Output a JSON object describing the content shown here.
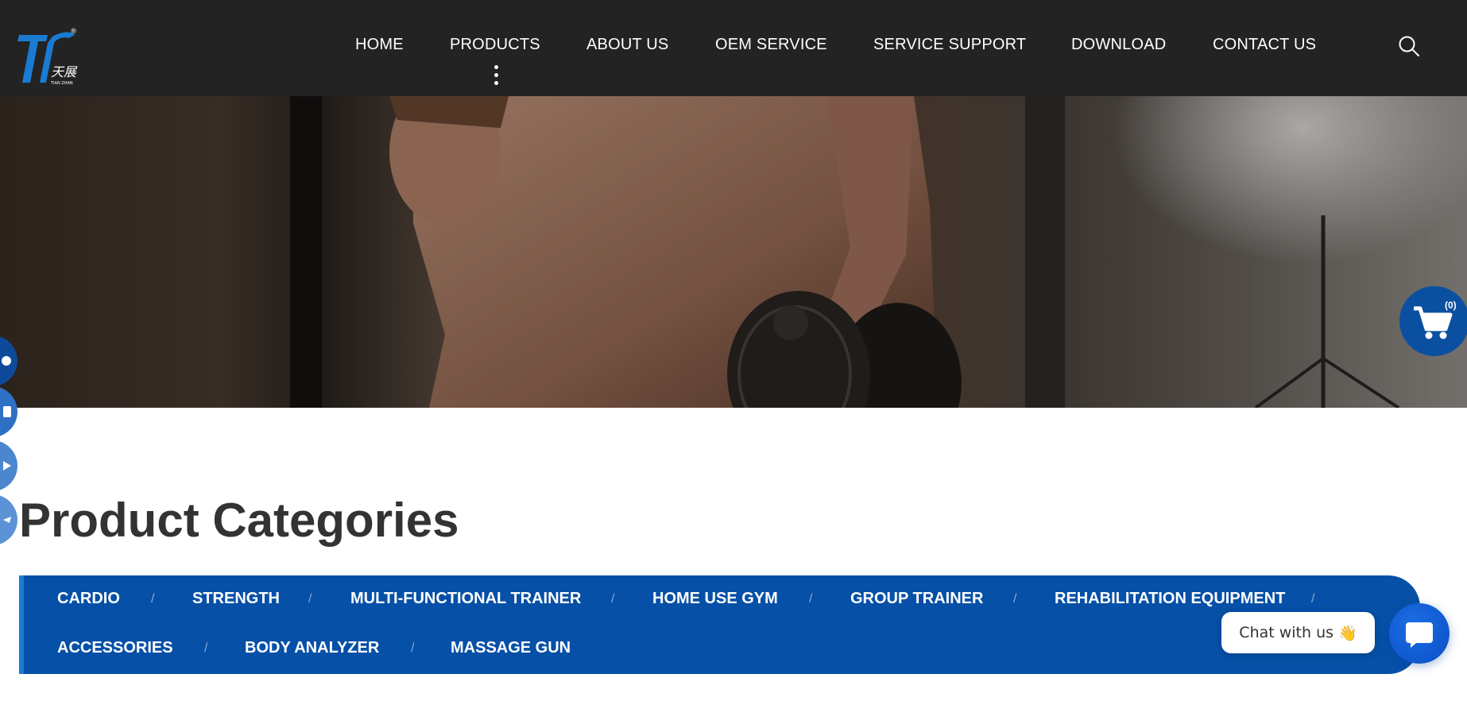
{
  "header": {
    "logo": {
      "mark": "TZ",
      "chinese_text": "天展",
      "subtext": "TIAN ZHAN",
      "registered": "®"
    },
    "nav": [
      {
        "label": "HOME"
      },
      {
        "label": "PRODUCTS"
      },
      {
        "label": "ABOUT US"
      },
      {
        "label": "OEM SERVICE"
      },
      {
        "label": "SERVICE SUPPORT"
      },
      {
        "label": "DOWNLOAD"
      },
      {
        "label": "CONTACT US"
      }
    ],
    "search_icon": "search-icon"
  },
  "hero": {
    "image": "man-dumbbell-row-photo"
  },
  "cart": {
    "count_label": "(0)",
    "icon": "shopping-cart-icon"
  },
  "social_dock": [
    {
      "icon": "social-icon-1"
    },
    {
      "icon": "social-icon-2"
    },
    {
      "icon": "social-icon-3"
    },
    {
      "icon": "social-icon-4"
    }
  ],
  "section": {
    "title": "Product Categories"
  },
  "categories": [
    {
      "label": "CARDIO"
    },
    {
      "label": "STRENGTH"
    },
    {
      "label": "MULTI-FUNCTIONAL TRAINER"
    },
    {
      "label": "HOME USE GYM"
    },
    {
      "label": "GROUP TRAINER"
    },
    {
      "label": "REHABILITATION EQUIPMENT"
    },
    {
      "label": "ACCESSORIES"
    },
    {
      "label": "BODY ANALYZER"
    },
    {
      "label": "MASSAGE GUN"
    }
  ],
  "category_separator": "/",
  "chat": {
    "bubble_text": "Chat with us",
    "emoji": "👋",
    "icon": "chat-icon"
  },
  "colors": {
    "header_bg": "#232323",
    "brand_blue": "#0650a7",
    "accent_blue": "#1a7bd3",
    "title_text": "#333333"
  }
}
